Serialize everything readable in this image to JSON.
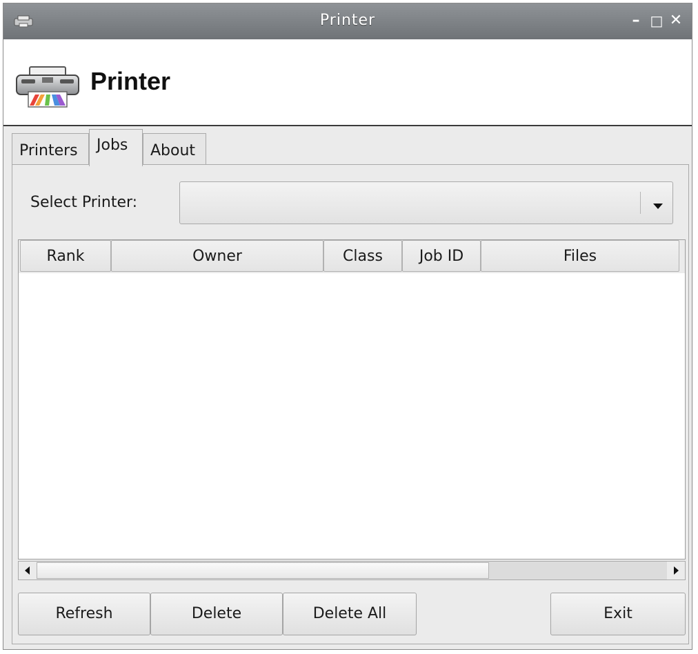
{
  "window": {
    "title": "Printer",
    "controls": {
      "minimize": "–",
      "maximize": "□",
      "close": "✕"
    }
  },
  "header": {
    "title": "Printer",
    "icon": "printer-icon"
  },
  "tabs": [
    {
      "label": "Printers",
      "active": false
    },
    {
      "label": "Jobs",
      "active": true
    },
    {
      "label": "About",
      "active": false
    }
  ],
  "jobs": {
    "select_label": "Select Printer:",
    "select_value": "",
    "columns": [
      "Rank",
      "Owner",
      "Class",
      "Job ID",
      "Files"
    ],
    "rows": [],
    "buttons": {
      "refresh": "Refresh",
      "delete": "Delete",
      "delete_all": "Delete All",
      "exit": "Exit"
    }
  }
}
